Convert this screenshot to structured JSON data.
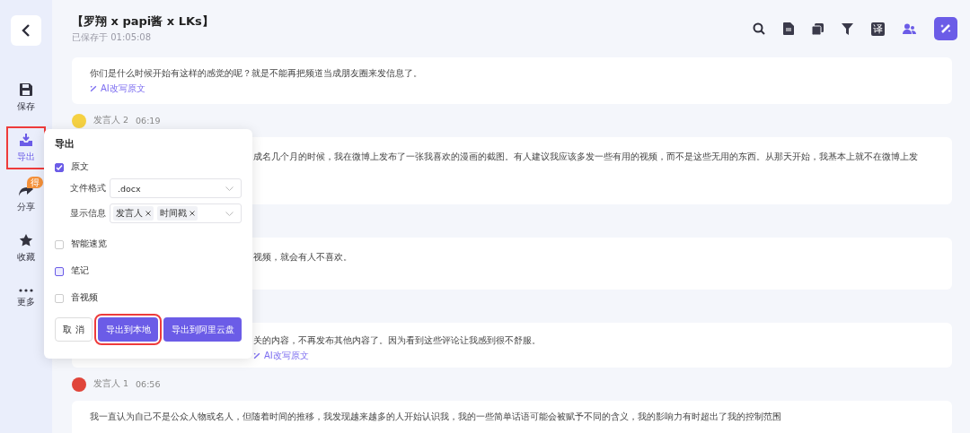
{
  "sidebar": {
    "items": [
      {
        "label": "保存",
        "selected": false,
        "highlighted": false
      },
      {
        "label": "导出",
        "selected": true,
        "highlighted": true
      },
      {
        "label": "分享",
        "selected": false,
        "highlighted": false,
        "badge": "得"
      },
      {
        "label": "收藏",
        "selected": false,
        "highlighted": false
      },
      {
        "label": "更多",
        "selected": false,
        "highlighted": false
      }
    ]
  },
  "header": {
    "title": "【罗翔 x papi酱 x LKs】",
    "saved": "已保存于 01:05:08",
    "translate_icon": "译"
  },
  "transcript": [
    {
      "kind": "full",
      "text": "你们是什么时候开始有这样的感觉的呢？就是不能再把频道当成朋友圈来发信息了。",
      "ai_link": "AI改写原文"
    },
    {
      "kind": "partial",
      "speaker": {
        "name": "发言人 2",
        "time": "06:19",
        "color": "#f5d142"
      },
      "text": "成名几个月的时候，我在微博上发布了一张我喜欢的漫画的截图。有人建议我应该多发一些有用的视频，而不是这些无用的东西。从那天开始，我基本上就不在微博上发"
    },
    {
      "kind": "partial",
      "text": "视频，就会有人不喜欢。"
    },
    {
      "kind": "partial",
      "text": "关的内容，不再发布其他内容了。因为看到这些评论让我感到很不舒服。",
      "ai_link": "AI改写原文"
    },
    {
      "kind": "full",
      "speaker": {
        "name": "发言人 1",
        "time": "06:56",
        "color": "#e0453a"
      },
      "text": "我一直认为自己不是公众人物或名人，但随着时间的推移，我发现越来越多的人开始认识我，我的一些简单话语可能会被赋予不同的含义，我的影响力有时超出了我的控制范围"
    }
  ],
  "export_dialog": {
    "title": "导出",
    "options": [
      {
        "label": "原文",
        "checked": true,
        "highlighted": false,
        "fields": [
          {
            "kind": "select",
            "label": "文件格式",
            "value": ".docx"
          },
          {
            "kind": "tags",
            "label": "显示信息",
            "tags": [
              "发言人",
              "时间戳"
            ]
          }
        ]
      },
      {
        "label": "智能速览",
        "checked": false,
        "highlighted": false
      },
      {
        "label": "笔记",
        "checked": false,
        "highlighted": true
      },
      {
        "label": "音视频",
        "checked": false,
        "highlighted": false
      }
    ],
    "buttons": [
      {
        "label": "取 消",
        "kind": "secondary",
        "highlighted": false
      },
      {
        "label": "导出到本地",
        "kind": "primary",
        "highlighted": true
      },
      {
        "label": "导出到阿里云盘",
        "kind": "primary",
        "highlighted": false
      }
    ]
  }
}
